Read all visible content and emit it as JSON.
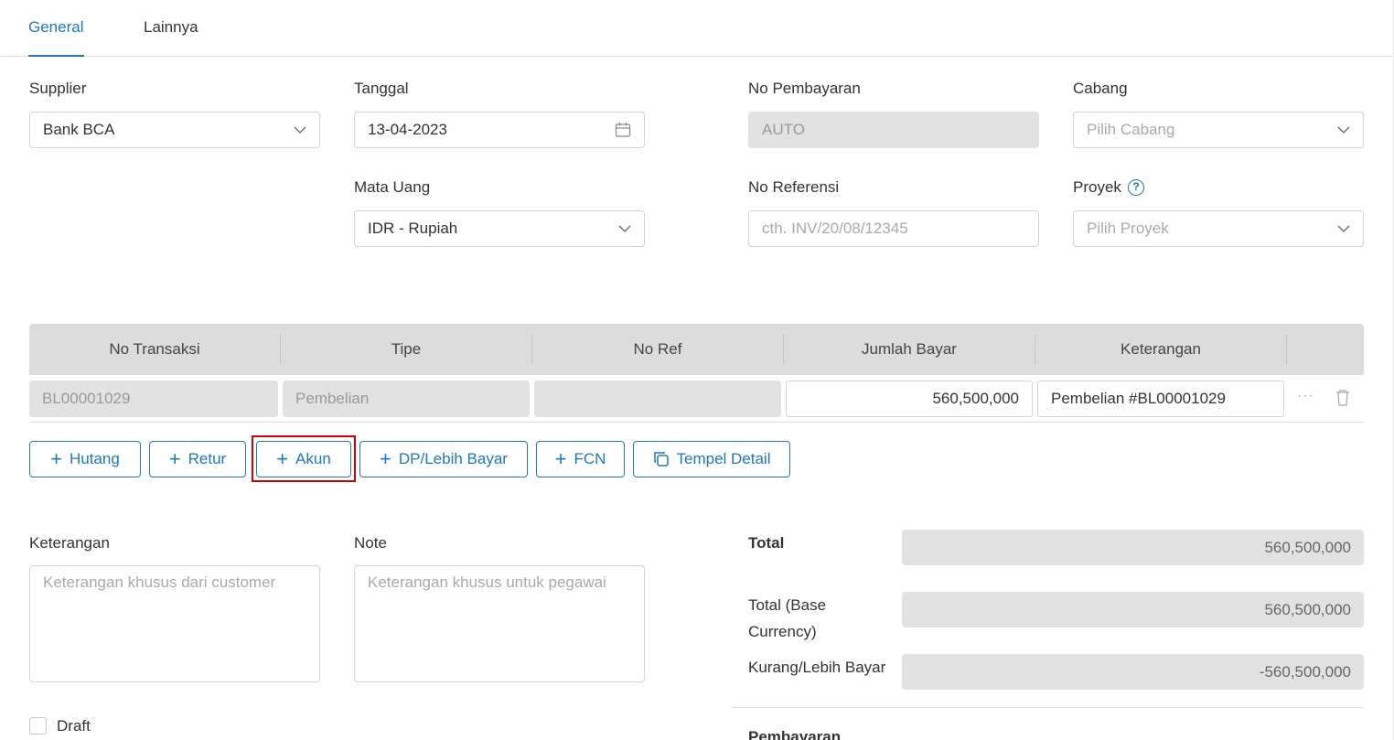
{
  "tabs": [
    {
      "label": "General",
      "active": true
    },
    {
      "label": "Lainnya",
      "active": false
    }
  ],
  "form": {
    "supplier": {
      "label": "Supplier",
      "value": "Bank BCA"
    },
    "tanggal": {
      "label": "Tanggal",
      "value": "13-04-2023"
    },
    "no_pembayaran": {
      "label": "No Pembayaran",
      "value": "AUTO"
    },
    "cabang": {
      "label": "Cabang",
      "placeholder": "Pilih Cabang"
    },
    "mata_uang": {
      "label": "Mata Uang",
      "value": "IDR - Rupiah"
    },
    "no_referensi": {
      "label": "No Referensi",
      "placeholder": "cth. INV/20/08/12345"
    },
    "proyek": {
      "label": "Proyek",
      "placeholder": "Pilih Proyek",
      "help": "?"
    }
  },
  "table": {
    "headers": [
      "No Transaksi",
      "Tipe",
      "No Ref",
      "Jumlah Bayar",
      "Keterangan"
    ],
    "rows": [
      {
        "no_transaksi": "BL00001029",
        "tipe": "Pembelian",
        "no_ref": "",
        "jumlah_bayar": "560,500,000",
        "keterangan": "Pembelian #BL00001029",
        "more": "···"
      }
    ]
  },
  "buttons": {
    "hutang": "Hutang",
    "retur": "Retur",
    "akun": "Akun",
    "dp": "DP/Lebih Bayar",
    "fcn": "FCN",
    "tempel": "Tempel Detail",
    "plus": "+"
  },
  "notes": {
    "keterangan": {
      "label": "Keterangan",
      "placeholder": "Keterangan khusus dari customer"
    },
    "note": {
      "label": "Note",
      "placeholder": "Keterangan khusus untuk pegawai"
    }
  },
  "totals": {
    "total_label": "Total",
    "total_value": "560,500,000",
    "base_label_1": "Total (Base",
    "base_label_2": "Currency)",
    "base_value": "560,500,000",
    "kurang_label": "Kurang/Lebih Bayar",
    "kurang_value": "-560,500,000"
  },
  "draft_label": "Draft",
  "pembayaran_label": "Pembayaran",
  "colors": {
    "accent": "#1d78c1",
    "highlight": "#d40000"
  }
}
